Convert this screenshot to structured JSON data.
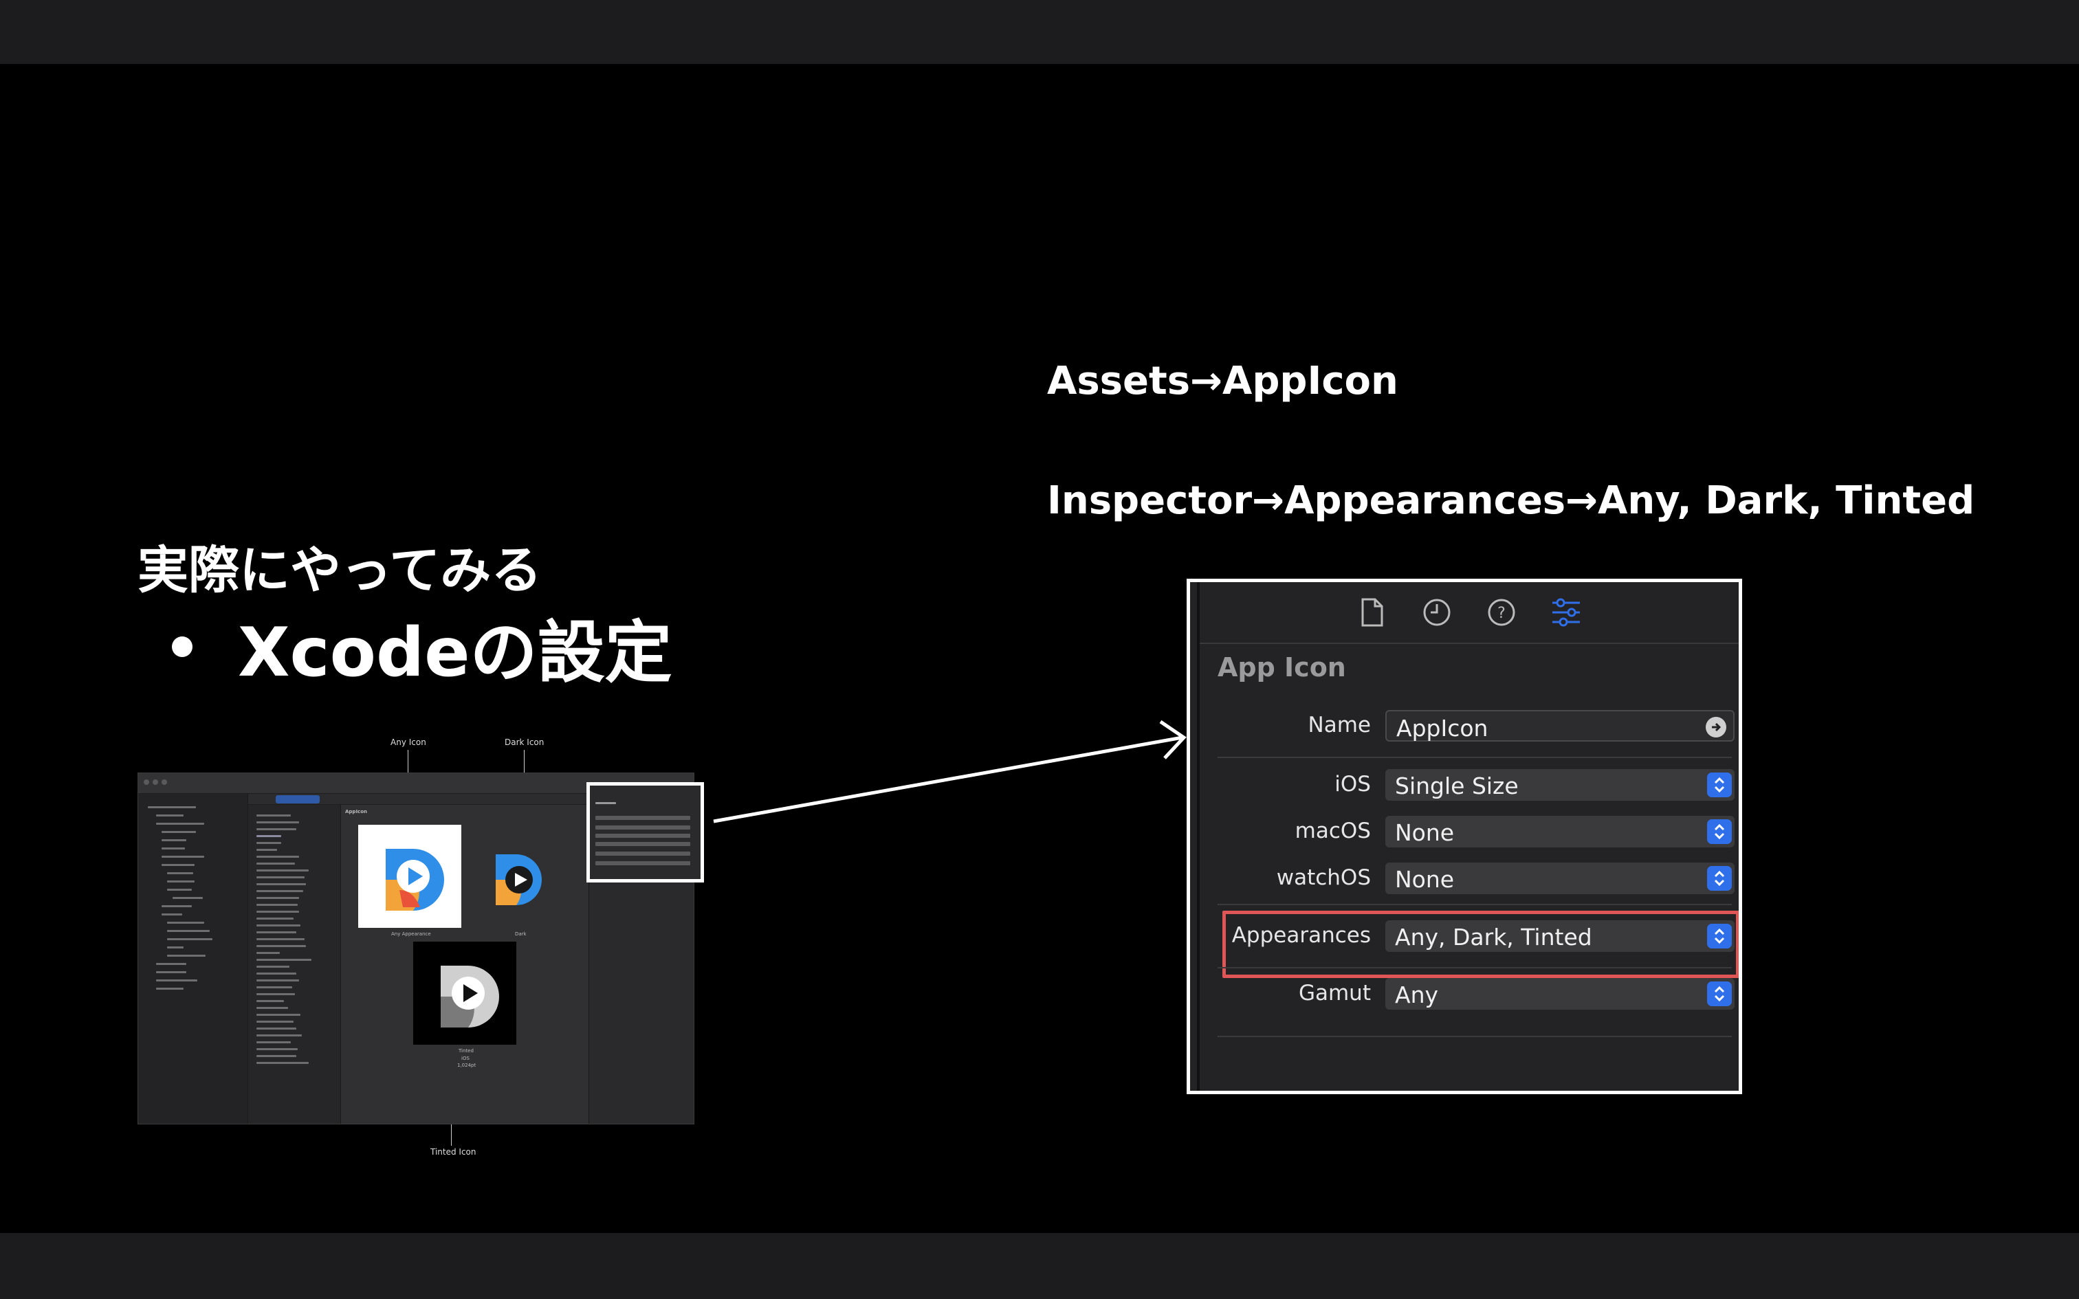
{
  "slide": {
    "heading": "実際にやってみる",
    "bullet": "Xcodeの設定",
    "step_assets": "Assets→AppIcon",
    "step_inspector": "Inspector→Appearances→Any, Dark, Tinted"
  },
  "mini_screenshot": {
    "callouts": {
      "any_icon": "Any Icon",
      "dark_icon": "Dark Icon",
      "tinted_icon": "Tinted Icon"
    },
    "canvas_title": "AppIcon",
    "labels": {
      "any": "Any Appearance",
      "dark": "Dark",
      "tinted": "Tinted",
      "platform": "iOS",
      "size": "1,024pt"
    }
  },
  "inspector": {
    "section_title": "App Icon",
    "tab_icons": [
      "file-icon",
      "history-clock-icon",
      "help-question-icon",
      "attributes-sliders-icon"
    ],
    "accent_color": "#2f6fea",
    "highlight_color": "#e05555",
    "fields": {
      "name": {
        "label": "Name",
        "value": "AppIcon"
      },
      "ios": {
        "label": "iOS",
        "value": "Single Size"
      },
      "macos": {
        "label": "macOS",
        "value": "None"
      },
      "watchos": {
        "label": "watchOS",
        "value": "None"
      },
      "appearances": {
        "label": "Appearances",
        "value": "Any, Dark, Tinted"
      },
      "gamut": {
        "label": "Gamut",
        "value": "Any"
      }
    }
  }
}
